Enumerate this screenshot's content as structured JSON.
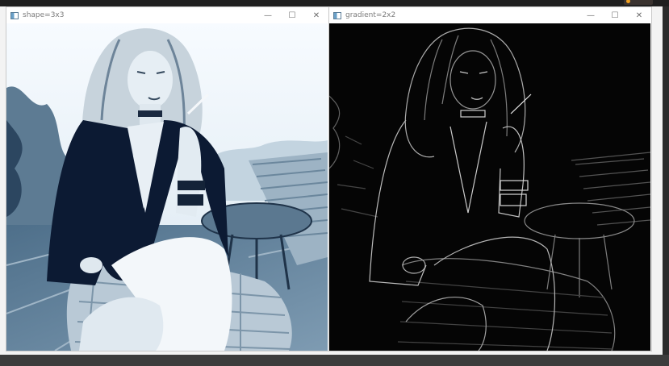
{
  "windows": [
    {
      "title": "shape=3x3",
      "controls": {
        "minimize": "—",
        "maximize": "☐",
        "close": "✕"
      }
    },
    {
      "title": "gradient=2x2",
      "controls": {
        "minimize": "—",
        "maximize": "☐",
        "close": "✕"
      }
    }
  ],
  "colors": {
    "desktop": "#2b2b2b",
    "titlebar": "#ffffff",
    "title_text": "#7a7a7a",
    "image_dark": "#0c1a33",
    "gradient_bg": "#050505"
  }
}
